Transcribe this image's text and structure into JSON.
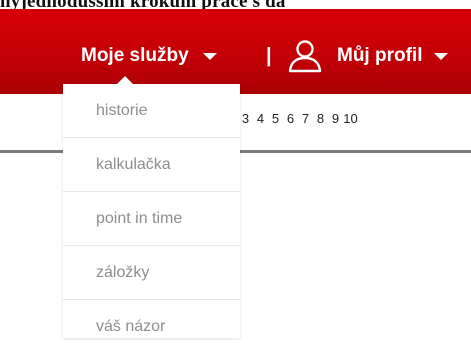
{
  "top_text": "nýjednodušším krokům práce s da",
  "header": {
    "services_label": "Moje služby",
    "separator": "|",
    "profile_label": "Můj profil"
  },
  "icons": {
    "caret": "chevron-down-icon",
    "user": "user-icon"
  },
  "colors": {
    "header_red": "#c40006",
    "menu_text": "#8e8e8e"
  },
  "pagination": [
    "3",
    "4",
    "5",
    "6",
    "7",
    "8",
    "9",
    "10"
  ],
  "dropdown": {
    "items": [
      {
        "label": "historie"
      },
      {
        "label": "kalkulačka"
      },
      {
        "label": "point in time"
      },
      {
        "label": "záložky"
      },
      {
        "label": "váš názor"
      }
    ]
  }
}
